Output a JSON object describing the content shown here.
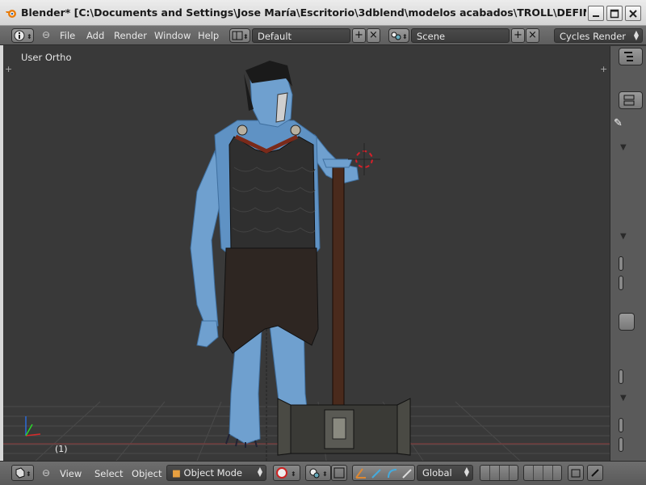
{
  "window": {
    "title": "Blender* [C:\\Documents and Settings\\Jose María\\Escritorio\\3dblend\\modelos acabados\\TROLL\\DEFINITIVOS\\DE ..."
  },
  "header": {
    "menus": [
      "File",
      "Add",
      "Render",
      "Window",
      "Help"
    ],
    "screen_layout": "Default",
    "scene": "Scene",
    "render_engine": "Cycles Render"
  },
  "viewport": {
    "view_label": "User Ortho",
    "frame_label": "(1)"
  },
  "footer": {
    "menus": [
      "View",
      "Select",
      "Object"
    ],
    "mode": "Object Mode",
    "orientation": "Global"
  },
  "colors": {
    "viewport_bg": "#393939",
    "troll_skin": "#6fa0cf",
    "armor": "#2f2f2f",
    "hammer_handle": "#4a2a1c",
    "cursor_red": "#d8202a"
  },
  "icons": [
    "blender-icon",
    "info-icon",
    "screen-layout-icon",
    "scene-icon",
    "add-icon",
    "close-icon",
    "view3d-icon",
    "cube-icon",
    "pivot-icon",
    "shading-icon",
    "manipulator-icon",
    "layers-icon",
    "lock-icon",
    "3d-cursor-icon"
  ]
}
